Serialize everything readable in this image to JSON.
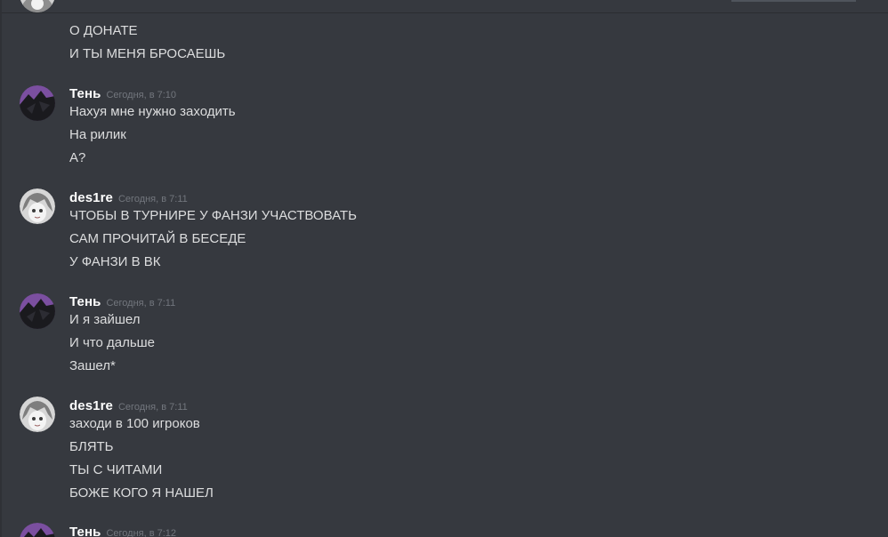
{
  "groups": [
    {
      "author": "",
      "time": "",
      "avatar": "cropped",
      "lines": [
        "О ДОНАТЕ",
        "И ТЫ МЕНЯ БРОСАЕШЬ"
      ]
    },
    {
      "author": "Тень",
      "time": "Сегодня, в 7:10",
      "avatar": "dark-purple-avatar",
      "lines": [
        "Нахуя мне нужно заходить",
        "На рилик",
        "А?"
      ]
    },
    {
      "author": "des1re",
      "time": "Сегодня, в 7:11",
      "avatar": "anime-girl-avatar",
      "lines": [
        "ЧТОБЫ В ТУРНИРЕ У ФАНЗИ УЧАСТВОВАТЬ",
        "САМ ПРОЧИТАЙ В БЕСЕДЕ",
        "У ФАНЗИ В ВК"
      ]
    },
    {
      "author": "Тень",
      "time": "Сегодня, в 7:11",
      "avatar": "dark-purple-avatar",
      "lines": [
        "И я зайшел",
        "И что дальше",
        "Зашел*"
      ]
    },
    {
      "author": "des1re",
      "time": "Сегодня, в 7:11",
      "avatar": "anime-girl-avatar",
      "lines": [
        "заходи в 100 игроков",
        "БЛЯТЬ",
        "ТЫ С ЧИТАМИ",
        "БОЖЕ КОГО Я НАШЕЛ"
      ]
    },
    {
      "author": "Тень",
      "time": "Сегодня, в 7:12",
      "avatar": "dark-purple-avatar",
      "lines": []
    }
  ]
}
